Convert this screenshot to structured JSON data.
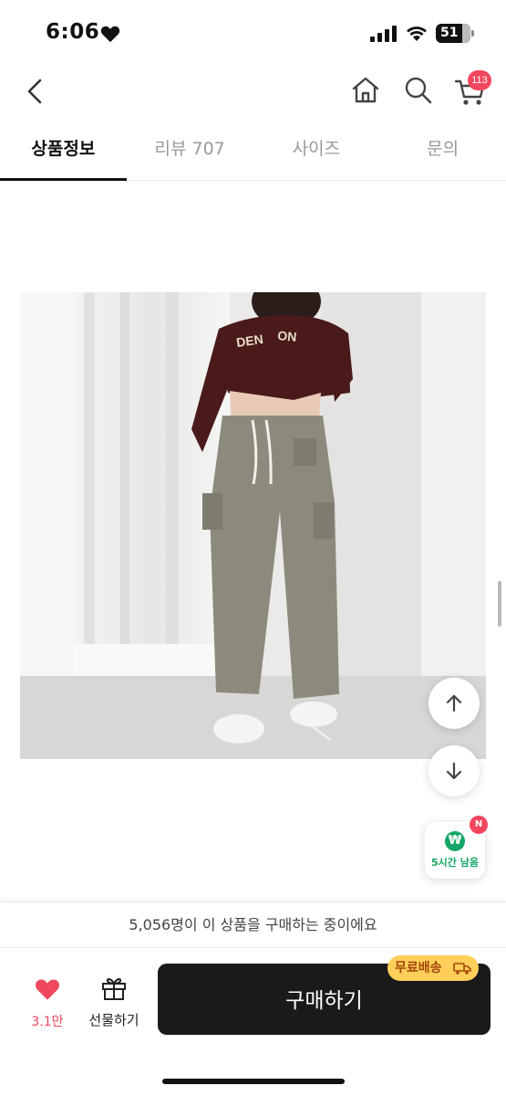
{
  "status": {
    "time": "6:06",
    "battery": "51"
  },
  "nav": {
    "cart_count": "113"
  },
  "tabs": [
    {
      "label": "상품정보",
      "active": true
    },
    {
      "label": "리뷰 707",
      "active": false
    },
    {
      "label": "사이즈",
      "active": false
    },
    {
      "label": "문의",
      "active": false
    }
  ],
  "timer": {
    "label": "5시간 남음",
    "badge": "N",
    "coin": "₩"
  },
  "footer": {
    "buyers_note": "5,056명이 이 상품을 구매하는 중이에요",
    "like_count": "3.1만",
    "gift_label": "선물하기",
    "buy_label": "구매하기",
    "free_shipping": "무료배송"
  },
  "colors": {
    "accent_pink": "#f0475f",
    "dark": "#1a1a1a",
    "green": "#15a667",
    "yellow": "#ffcf5a"
  }
}
